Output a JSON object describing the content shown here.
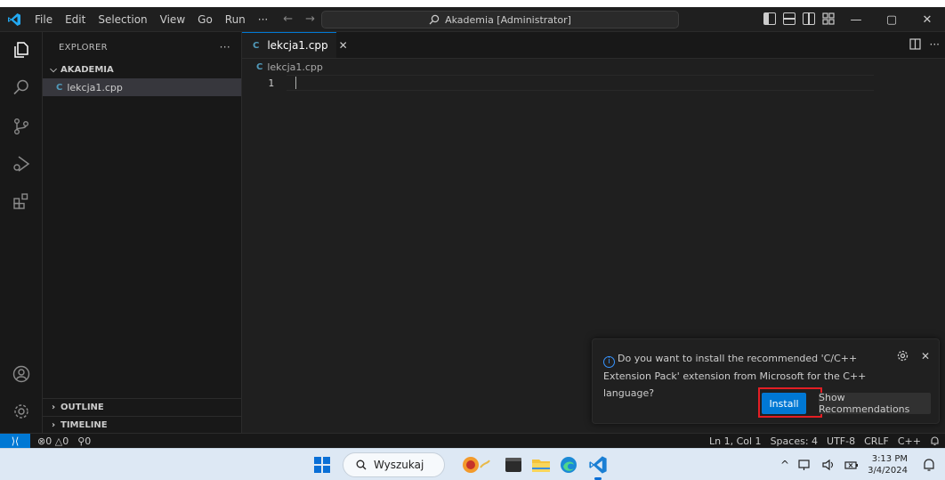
{
  "titlebar": {
    "menu": [
      "File",
      "Edit",
      "Selection",
      "View",
      "Go",
      "Run"
    ],
    "more": "···",
    "back": "←",
    "forward": "→",
    "search_text": "Akademia [Administrator]",
    "minimize": "—",
    "maximize": "▢",
    "close": "✕"
  },
  "sidebar": {
    "header": "EXPLORER",
    "header_more": "···",
    "folder": "AKADEMIA",
    "file": "lekcja1.cpp",
    "file_badge": "C",
    "outline": "OUTLINE",
    "timeline": "TIMELINE"
  },
  "editor": {
    "tab_label": "lekcja1.cpp",
    "tab_close": "✕",
    "tab_badge": "C",
    "breadcrumb": "lekcja1.cpp",
    "line_number": "1"
  },
  "notification": {
    "message": "Do you want to install the recommended 'C/C++ Extension Pack' extension from Microsoft for the C++ language?",
    "install_label": "Install",
    "recommendations_label": "Show Recommendations",
    "close": "✕"
  },
  "statusbar": {
    "errors": "0",
    "warnings": "0",
    "ports": "0",
    "cursor_pos": "Ln 1, Col 1",
    "spaces": "Spaces: 4",
    "encoding": "UTF-8",
    "eol": "CRLF",
    "language": "C++"
  },
  "taskbar": {
    "search_placeholder": "Wyszukaj",
    "time": "3:13 PM",
    "date": "3/4/2024",
    "tray_chevron": "^"
  },
  "colors": {
    "accent": "#0078d4",
    "highlight_box": "#e31e24",
    "editor_bg": "#1f1f1f",
    "sidebar_bg": "#181818"
  }
}
